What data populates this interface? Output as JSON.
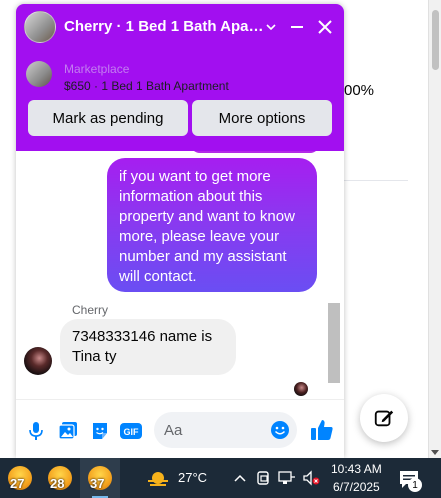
{
  "background": {
    "percent_text": "00%"
  },
  "chat": {
    "title": "Cherry · 1 Bed 1 Bath Apart…",
    "listing": {
      "kicker": "Marketplace",
      "description": "$650 · 1 Bed 1 Bath Apartment"
    },
    "buttons": {
      "mark_pending": "Mark as pending",
      "more_options": "More options"
    },
    "messages": [
      {
        "direction": "outgoing",
        "text": "if you want to get more information about this property and want to know more, please leave your number and my assistant will contact."
      },
      {
        "direction": "incoming",
        "sender": "Cherry",
        "text": "7348333146 name is Tina ty"
      }
    ],
    "composer": {
      "placeholder": "Aa",
      "icons": [
        "microphone-icon",
        "photo-icon",
        "sticker-icon",
        "gif-icon",
        "emoji-icon",
        "thumbs-up-icon"
      ],
      "gif_label": "GIF"
    },
    "colors": {
      "header": "#a20ff0",
      "accent_blue": "#0084ff"
    }
  },
  "taskbar": {
    "apps": [
      {
        "label": "27",
        "active": false
      },
      {
        "label": "28",
        "active": false
      },
      {
        "label": "37",
        "active": true
      }
    ],
    "weather": {
      "temperature": "27°C"
    },
    "clock": {
      "time": "10:43 AM",
      "date": "6/7/2025"
    },
    "notification_count": "1"
  }
}
